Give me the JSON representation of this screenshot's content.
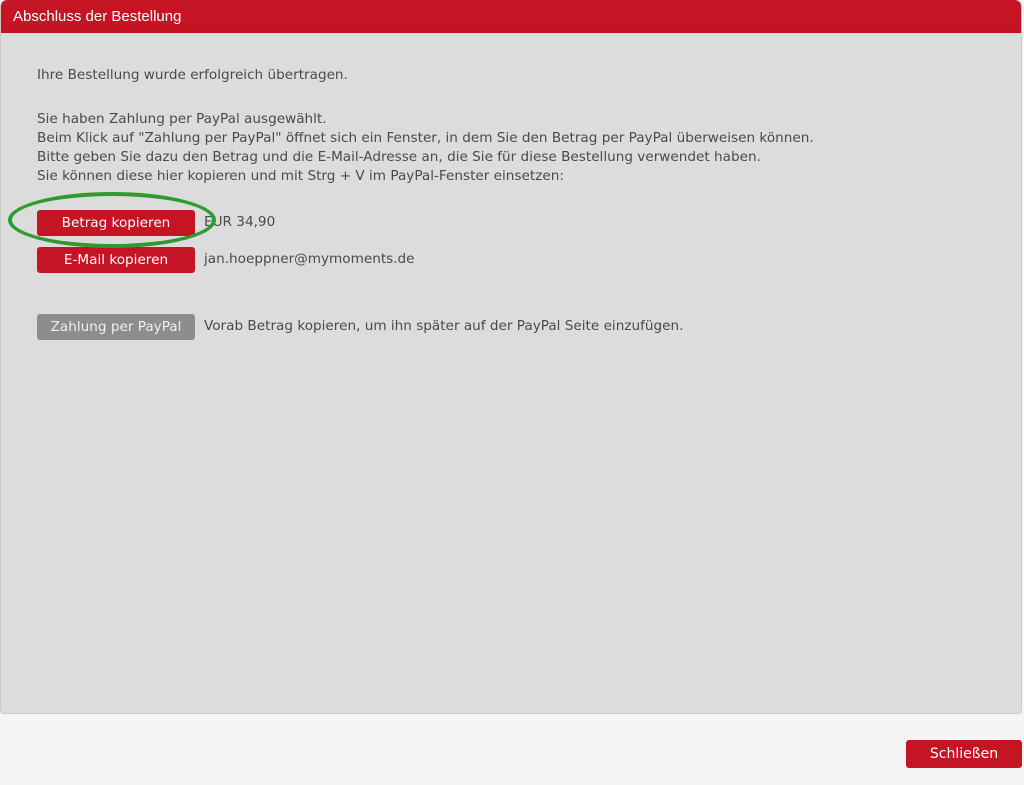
{
  "dialog": {
    "title": "Abschluss der Bestellung"
  },
  "content": {
    "confirmation_text": "Ihre Bestellung wurde erfolgreich übertragen.",
    "info_lines": [
      "Sie haben Zahlung per PayPal ausgewählt.",
      "Beim Klick auf \"Zahlung per PayPal\" öffnet sich ein Fenster, in dem Sie den Betrag per PayPal überweisen können.",
      "Bitte geben Sie dazu den Betrag und die E-Mail-Adresse an, die Sie für diese Bestellung verwendet haben.",
      "Sie können diese hier kopieren und mit Strg + V im PayPal-Fenster einsetzen:"
    ],
    "copy_amount": {
      "button_label": "Betrag kopieren",
      "value": "EUR 34,90"
    },
    "copy_email": {
      "button_label": "E-Mail kopieren",
      "value": "jan.hoeppner@mymoments.de"
    },
    "paypal": {
      "button_label": "Zahlung per PayPal",
      "hint": "Vorab Betrag kopieren, um ihn später auf der PayPal Seite einzufügen."
    }
  },
  "footer": {
    "close_label": "Schließen"
  },
  "colors": {
    "accent_red": "#c51524",
    "dialog_background": "#dcdcdc",
    "disabled_button": "#8d8d8d",
    "annotation_green": "#2e9b2e"
  }
}
